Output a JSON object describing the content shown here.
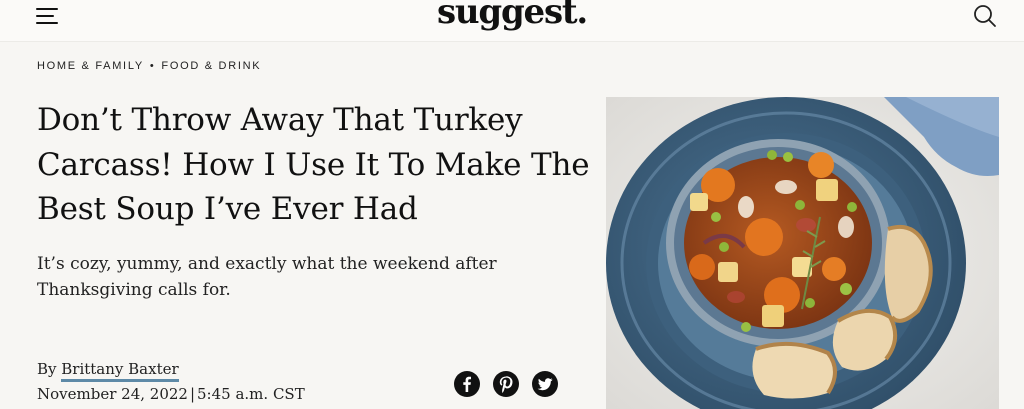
{
  "header": {
    "logo_text": "suggest."
  },
  "breadcrumb": {
    "items": [
      {
        "label": "HOME & FAMILY"
      },
      {
        "label": "FOOD & DRINK"
      }
    ],
    "separator": "•"
  },
  "article": {
    "headline": "Don’t Throw Away That Turkey Carcass! How I Use It To Make The Best Soup I’ve Ever Had",
    "subheadline": "It’s cozy, yummy, and exactly what the weekend after Thanksgiving calls for.",
    "byline_prefix": "By ",
    "author": "Brittany Baxter",
    "date": "November 24, 2022",
    "date_separator": "|",
    "time": "5:45 a.m. CST"
  },
  "share": {
    "icons": [
      "facebook-icon",
      "pinterest-icon",
      "twitter-icon"
    ]
  },
  "colors": {
    "background": "#f7f6f3",
    "author_underline": "#5e8aa7",
    "text": "#111111"
  }
}
